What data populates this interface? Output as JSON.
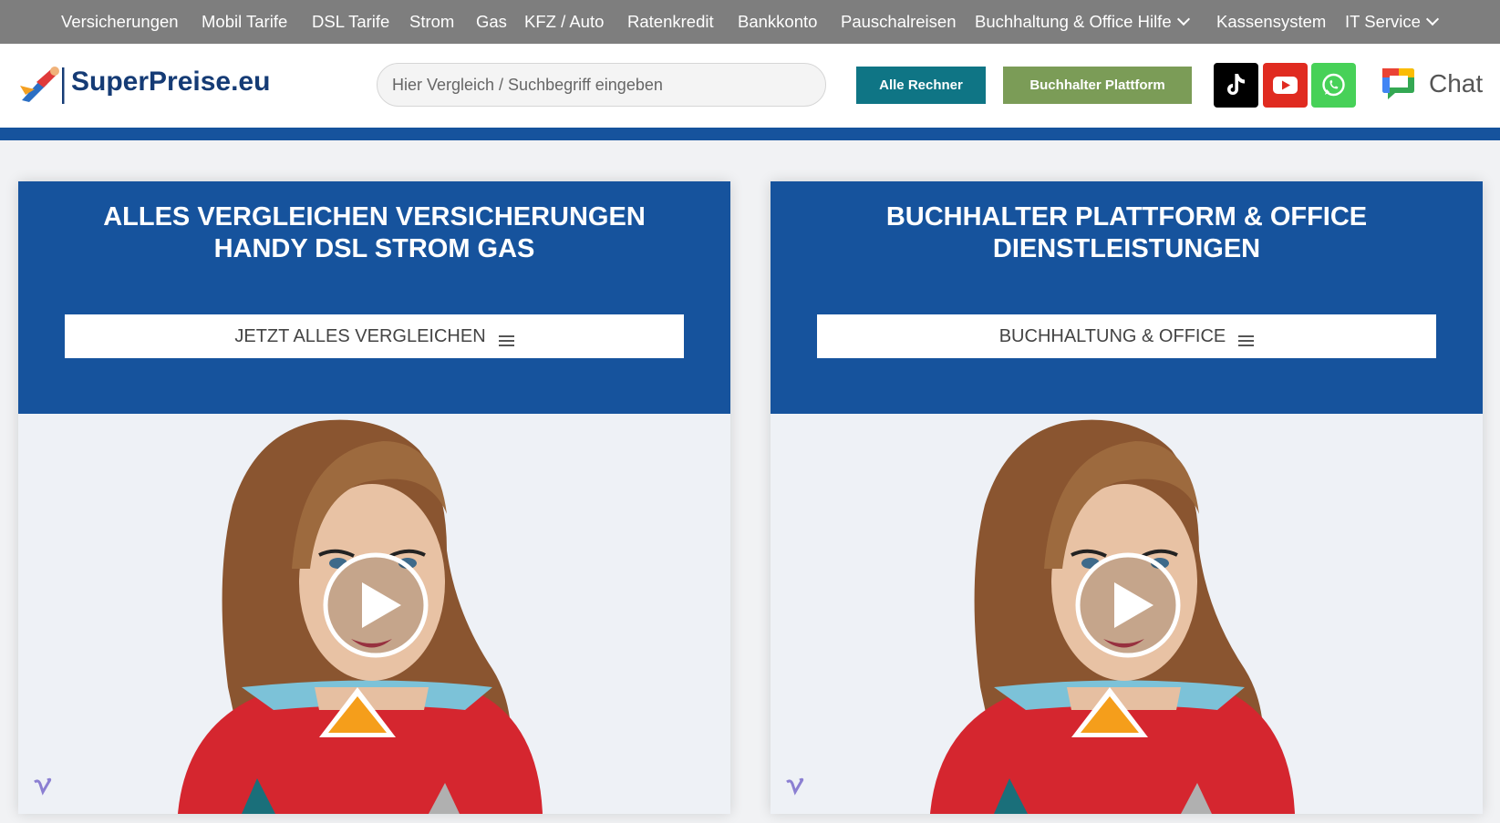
{
  "topnav": {
    "items": [
      {
        "label": "Versicherungen",
        "dropdown": false
      },
      {
        "label": "Mobil Tarife",
        "dropdown": false
      },
      {
        "label": "DSL Tarife",
        "dropdown": false
      },
      {
        "label": "Strom",
        "dropdown": false
      },
      {
        "label": "Gas",
        "dropdown": false
      },
      {
        "label": "KFZ / Auto",
        "dropdown": false
      },
      {
        "label": "Ratenkredit",
        "dropdown": false
      },
      {
        "label": "Bankkonto",
        "dropdown": false
      },
      {
        "label": "Pauschalreisen",
        "dropdown": false
      },
      {
        "label": "Buchhaltung & Office Hilfe",
        "dropdown": true
      },
      {
        "label": "Kassensystem",
        "dropdown": false
      },
      {
        "label": "IT Service",
        "dropdown": true
      }
    ]
  },
  "header": {
    "logo_text": "SuperPreise.eu",
    "search_placeholder": "Hier Vergleich / Suchbegriff eingeben",
    "btn_rechner": "Alle Rechner",
    "btn_buchhalter": "Buchhalter Plattform",
    "social": {
      "tiktok": "tiktok-icon",
      "youtube": "youtube-icon",
      "whatsapp": "whatsapp-icon",
      "chat": "google-chat-icon"
    },
    "chat_label": "Chat"
  },
  "panels": [
    {
      "title": "ALLES VERGLEICHEN VERSICHERUNGEN\nHANDY DSL STROM GAS",
      "button": "JETZT ALLES VERGLEICHEN"
    },
    {
      "title": "BUCHHALTER PLATTFORM & OFFICE\nDIENSTLEISTUNGEN",
      "button": "BUCHHALTUNG & OFFICE"
    }
  ],
  "colors": {
    "nav_bg": "#7e7e7e",
    "brand_blue": "#16539d",
    "logo_text": "#153b75",
    "btn_rechner": "#0f7585",
    "btn_buchhalter": "#7b9c57",
    "tiktok": "#000000",
    "youtube": "#e02b20",
    "whatsapp": "#47d158"
  }
}
